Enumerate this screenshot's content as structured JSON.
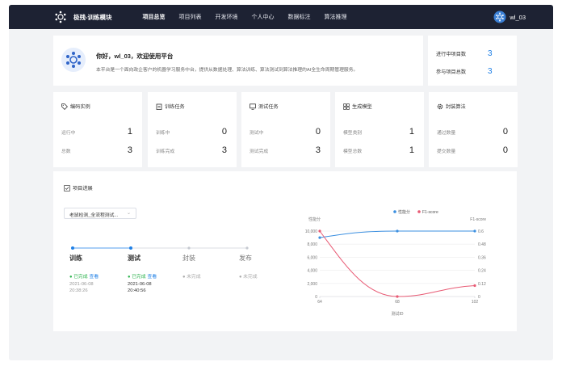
{
  "nav": {
    "brand": "极残-训练模块",
    "items": [
      "项目总览",
      "项目列表",
      "开发环境",
      "个人中心",
      "数据标注",
      "算法推理"
    ],
    "user": "wl_03"
  },
  "welcome": {
    "title": "你好，wl_03，欢迎使用平台",
    "desc": "本平台是一个面向政企客户的机器学习服务中台，提供从数据处理、算法训练、算法测试到算法推理的AI全生命周期管理服务。"
  },
  "project_stats": {
    "running_label": "进行中项目数",
    "running_value": "3",
    "joined_label": "参与项目总数",
    "joined_value": "3"
  },
  "cards": [
    {
      "title": "编码实例",
      "icon": "tag-icon",
      "r1_label": "运行中",
      "r1_value": "1",
      "r2_label": "总数",
      "r2_value": "3"
    },
    {
      "title": "训练任务",
      "icon": "clipboard-icon",
      "r1_label": "训练中",
      "r1_value": "0",
      "r2_label": "训练完成",
      "r2_value": "3"
    },
    {
      "title": "测试任务",
      "icon": "monitor-icon",
      "r1_label": "测试中",
      "r1_value": "0",
      "r2_label": "测试完成",
      "r2_value": "3"
    },
    {
      "title": "生成模型",
      "icon": "grid-icon",
      "r1_label": "模型类别",
      "r1_value": "1",
      "r2_label": "模型总数",
      "r2_value": "1"
    },
    {
      "title": "封装算法",
      "icon": "gear-icon",
      "r1_label": "通过数量",
      "r1_value": "0",
      "r2_label": "提交数量",
      "r2_value": "0"
    }
  ],
  "progress": {
    "title": "项目进展",
    "select_value": "老鼠检测_全流程测试...",
    "steps": [
      {
        "label": "训练",
        "status": "已完成",
        "view": "查看",
        "time1": "2021-06-08",
        "time2": "20:38:26",
        "state": "done"
      },
      {
        "label": "测试",
        "status": "已完成",
        "view": "查看",
        "time1": "2021-06-08",
        "time2": "20:40:56",
        "state": "done"
      },
      {
        "label": "封装",
        "status": "未完成",
        "view": "",
        "time1": "",
        "time2": "",
        "state": "pending"
      },
      {
        "label": "发布",
        "status": "未完成",
        "view": "",
        "time1": "",
        "time2": "",
        "state": "pending"
      }
    ]
  },
  "chart_data": {
    "type": "line",
    "x": [
      64,
      68,
      102
    ],
    "xlabel": "测试ID",
    "ylabel_left": "性能分",
    "ylabel_right": "F1-score",
    "ylim_left": [
      0,
      10000
    ],
    "ylim_right": [
      0,
      0.6
    ],
    "yticks_left": [
      "0",
      "2,000",
      "4,000",
      "6,000",
      "8,000",
      "10,000"
    ],
    "yticks_right": [
      "0",
      "0.12",
      "0.24",
      "0.36",
      "0.48",
      "0.6"
    ],
    "legend_position": "top",
    "series": [
      {
        "name": "性能分",
        "axis": "left",
        "color": "#3b8fe0",
        "values": [
          9000,
          10000,
          10000
        ]
      },
      {
        "name": "F1-score",
        "axis": "right",
        "color": "#e85a74",
        "values": [
          0.6,
          0.0,
          0.1
        ]
      }
    ]
  },
  "colors": {
    "accent": "#1e7fe6",
    "nav_bg": "#1d2233",
    "success": "#2bb24c"
  }
}
